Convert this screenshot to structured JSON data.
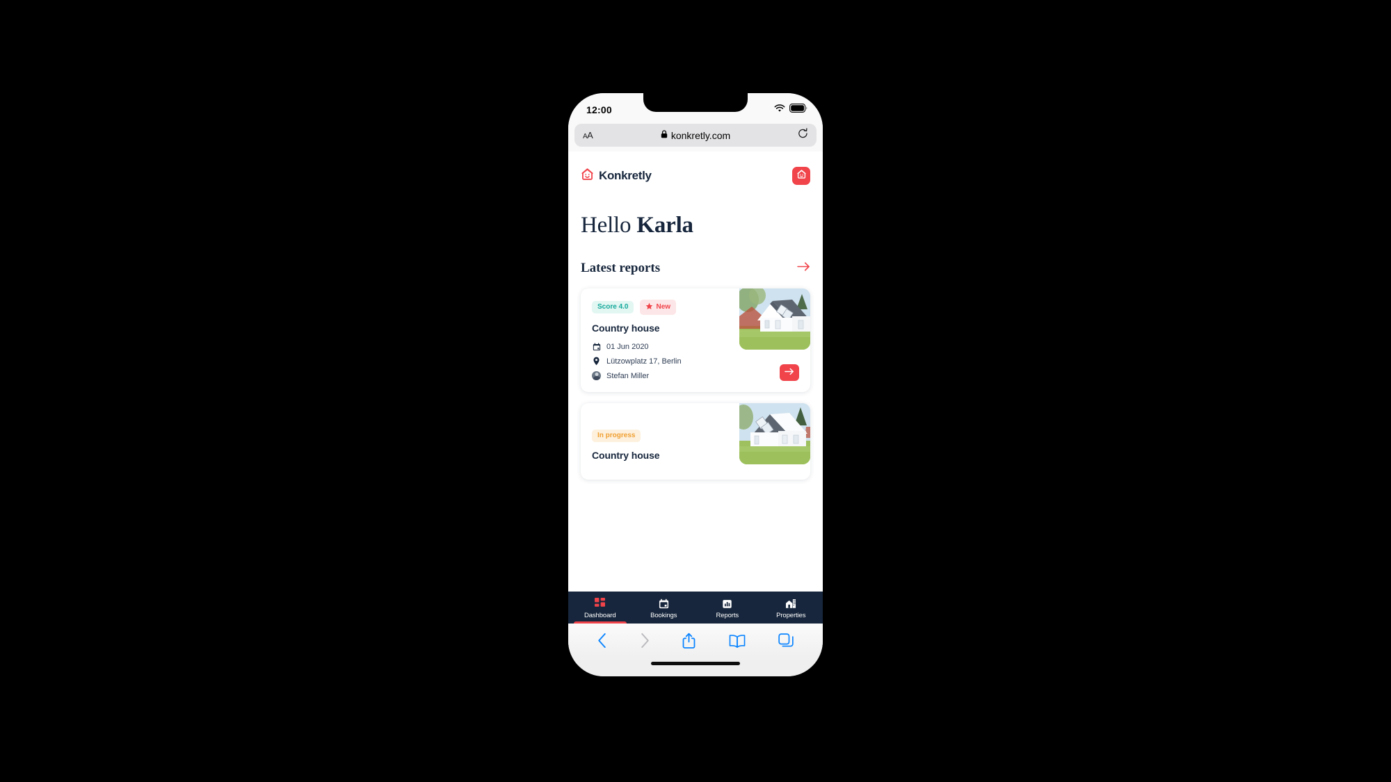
{
  "device": {
    "status_bar": {
      "time": "12:00",
      "wifi_icon": "wifi-icon",
      "battery_icon": "battery-full-icon"
    },
    "browser": {
      "text_size_label": "AA",
      "lock_icon": "lock-icon",
      "url": "konkretly.com",
      "reload_icon": "reload-icon",
      "toolbar": {
        "back_icon": "chevron-left-icon",
        "forward_icon": "chevron-right-icon",
        "share_icon": "share-icon",
        "bookmarks_icon": "book-icon",
        "tabs_icon": "tabs-icon"
      }
    }
  },
  "app": {
    "brand": {
      "name": "Konkretly",
      "logo_icon": "house-smiley-icon"
    },
    "header_action": {
      "icon": "house-smiley-icon",
      "color": "#f0434a"
    },
    "greeting": {
      "prefix": "Hello ",
      "name": "Karla"
    },
    "section": {
      "title": "Latest reports",
      "arrow_icon": "arrow-right-icon"
    },
    "reports": [
      {
        "badges": [
          {
            "type": "score",
            "label": "Score 4.0",
            "icon": null
          },
          {
            "type": "new",
            "label": "New",
            "icon": "star-icon"
          }
        ],
        "title": "Country house",
        "date": "01 Jun 2020",
        "date_icon": "calendar-icon",
        "address": "Lützowplatz 17, Berlin",
        "address_icon": "map-pin-icon",
        "person": "Stefan Miller",
        "person_icon": "avatar-icon",
        "action_icon": "arrow-right-icon",
        "photo": "house-photo"
      },
      {
        "badges": [
          {
            "type": "progress",
            "label": "In progress",
            "icon": null
          }
        ],
        "title": "Country house",
        "photo": "house-photo"
      }
    ],
    "bottom_nav": [
      {
        "label": "Dashboard",
        "icon": "grid-icon",
        "active": true
      },
      {
        "label": "Bookings",
        "icon": "calendar-icon",
        "active": false
      },
      {
        "label": "Reports",
        "icon": "bar-chart-icon",
        "active": false
      },
      {
        "label": "Properties",
        "icon": "building-icon",
        "active": false
      }
    ]
  },
  "colors": {
    "brand_red": "#f0434a",
    "navy": "#17263c",
    "teal": "#14a99b",
    "orange": "#f0a033"
  }
}
